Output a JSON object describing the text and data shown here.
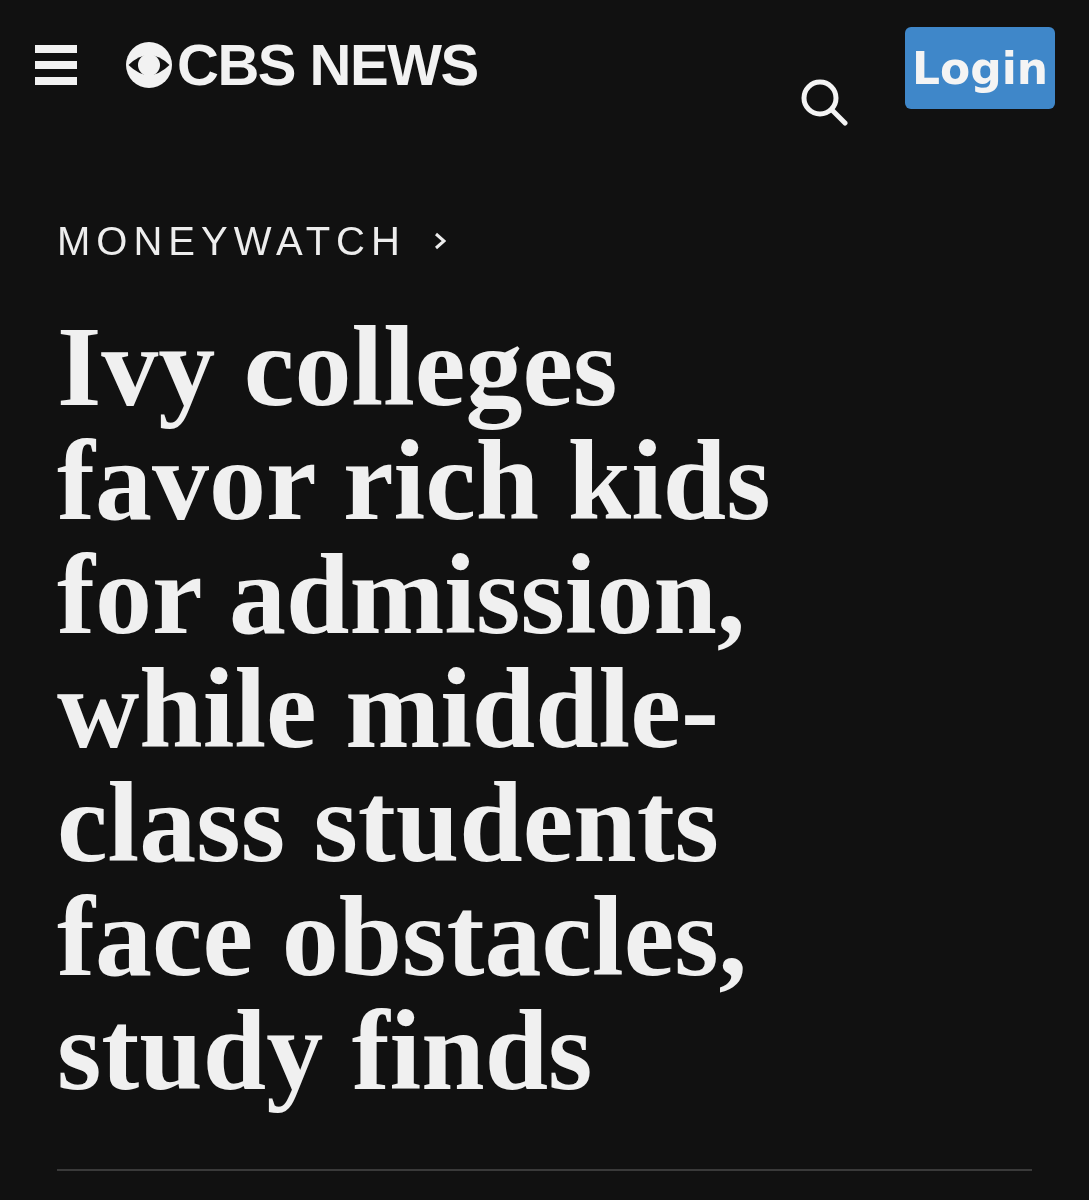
{
  "header": {
    "logo_text": "CBS NEWS",
    "login_button": "Login"
  },
  "breadcrumb": {
    "section": "MONEYWATCH"
  },
  "headline": "Ivy colleges favor rich kids for admission, while middle-class students face obstacles, study finds"
}
